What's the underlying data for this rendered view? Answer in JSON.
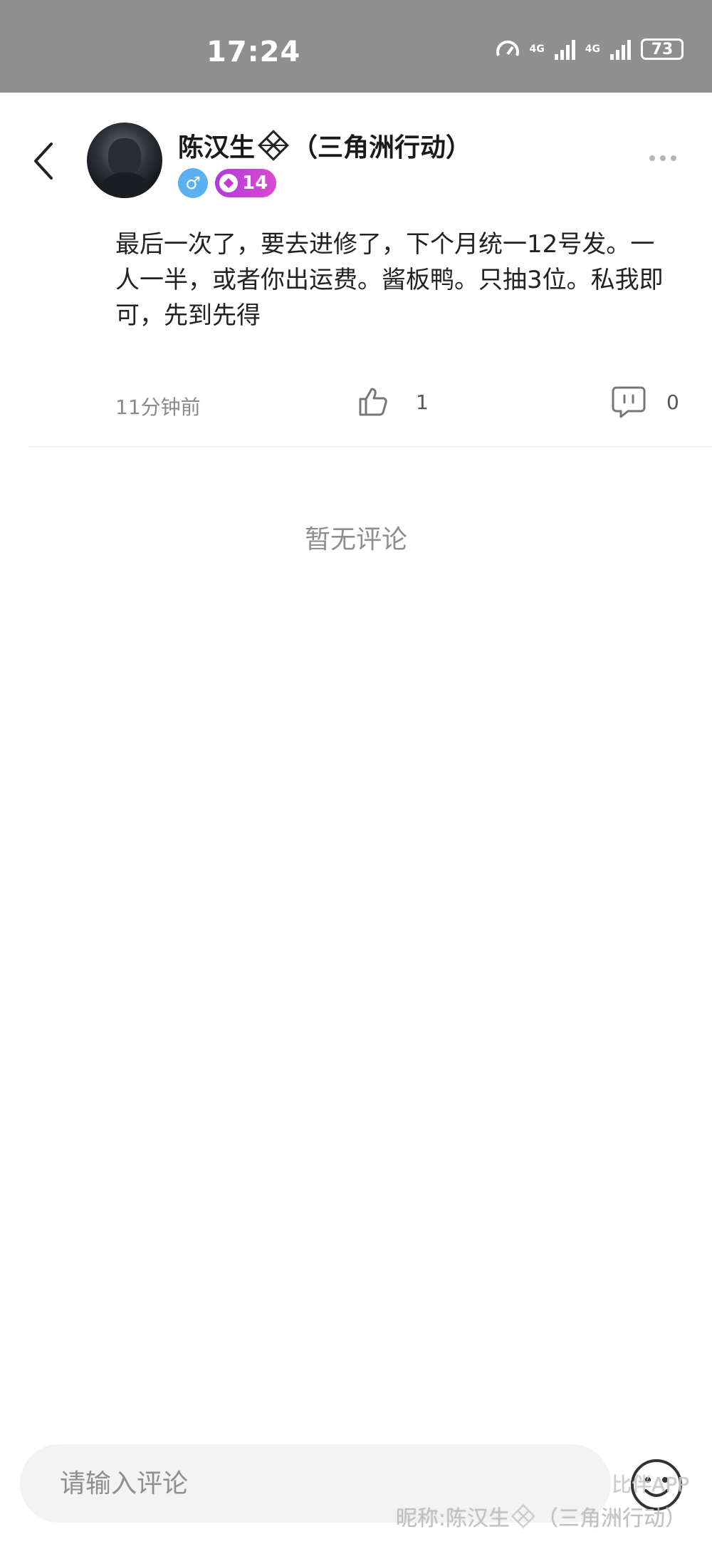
{
  "status_bar": {
    "time": "17:24",
    "network_1": "4G",
    "network_2": "4G",
    "battery": "73"
  },
  "header": {
    "username_main": "陈汉生",
    "username_suffix": "（三角洲行动）",
    "level": "14"
  },
  "post": {
    "text": "最后一次了，要去进修了，下个月统一12号发。一人一半，或者你出运费。酱板鸭。只抽3位。私我即可，先到先得",
    "time": "11分钟前",
    "like_count": "1",
    "comment_count": "0"
  },
  "comments": {
    "empty_text": "暂无评论"
  },
  "input": {
    "placeholder": "请输入评论"
  },
  "watermark": {
    "app": "比伴APP",
    "nick_prefix": "昵称:陈汉生",
    "nick_suffix": "（三角洲行动）"
  },
  "icons": {
    "back": "back-arrow-icon",
    "more": "more-icon",
    "like": "thumbs-up-icon",
    "comment": "comment-icon",
    "emoji": "emoji-icon",
    "emblem": "game-emblem-icon"
  },
  "colors": {
    "status_bar": "#8f8f8f",
    "gender_badge": "#5ab0f0",
    "level_badge": "#c23ad4"
  }
}
